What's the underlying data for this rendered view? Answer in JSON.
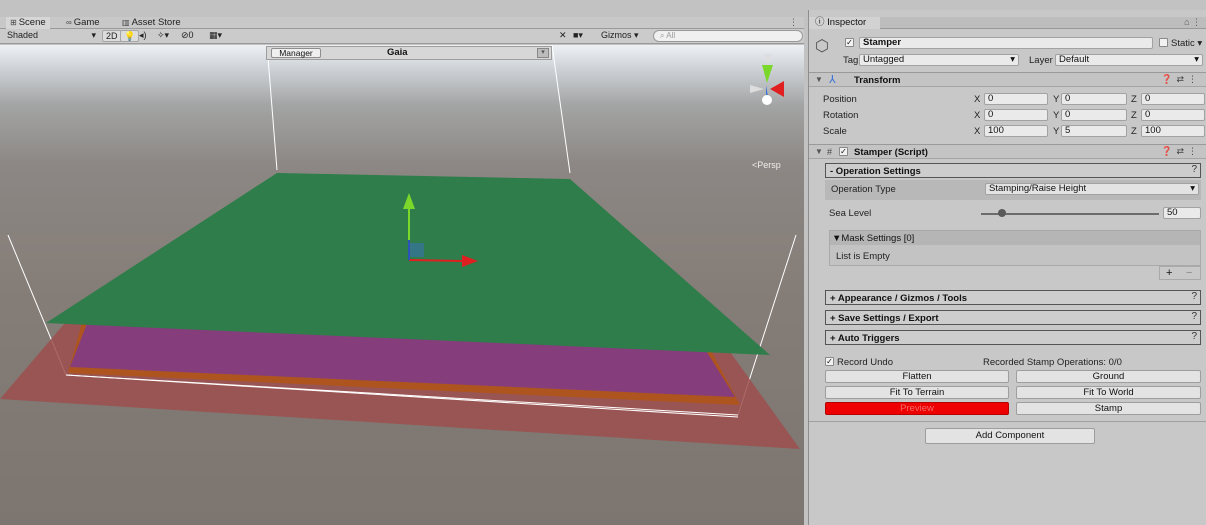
{
  "scene_tabs": [
    {
      "label": "Scene",
      "icon": "#"
    },
    {
      "label": "Game",
      "icon": "∞"
    },
    {
      "label": "Asset Store",
      "icon": "▥"
    }
  ],
  "toolbar": {
    "shading": "Shaded",
    "mode_2d": "2D",
    "hidden_count": "0",
    "gizmos": "Gizmos",
    "search_placeholder": "All"
  },
  "gaia": {
    "manager_button": "Manager",
    "title": "Gaia"
  },
  "view_label": "Persp",
  "inspector": {
    "tab": "Inspector",
    "object_name": "Stamper",
    "static_label": "Static",
    "tag_label": "Tag",
    "tag_value": "Untagged",
    "layer_label": "Layer",
    "layer_value": "Default",
    "transform": {
      "title": "Transform",
      "rows": [
        {
          "label": "Position",
          "x": "0",
          "y": "0",
          "z": "0"
        },
        {
          "label": "Rotation",
          "x": "0",
          "y": "0",
          "z": "0"
        },
        {
          "label": "Scale",
          "x": "100",
          "y": "5",
          "z": "100"
        }
      ]
    },
    "script": {
      "title": "Stamper (Script)",
      "operation_settings": "- Operation Settings",
      "operation_type_label": "Operation Type",
      "operation_type_value": "Stamping/Raise Height",
      "sea_level_label": "Sea Level",
      "sea_level_value": "50",
      "sea_level_fraction": 0.12,
      "mask_settings": "Mask Settings [0]",
      "list_empty": "List is Empty",
      "appearance": "+ Appearance / Gizmos / Tools",
      "save_settings": "+ Save Settings / Export",
      "auto_triggers": "+ Auto Triggers",
      "record_undo": "Record Undo",
      "recorded_ops": "Recorded Stamp Operations: 0/0",
      "buttons": {
        "flatten": "Flatten",
        "ground": "Ground",
        "fit_terrain": "Fit To Terrain",
        "fit_world": "Fit To World",
        "preview": "Preview",
        "stamp": "Stamp"
      }
    },
    "add_component": "Add Component"
  },
  "colors": {
    "terrain_plane": "#2e7d4a",
    "preview_button": "#ee0000",
    "gizmo_y": "#7bd82a",
    "gizmo_x": "#e02020"
  }
}
